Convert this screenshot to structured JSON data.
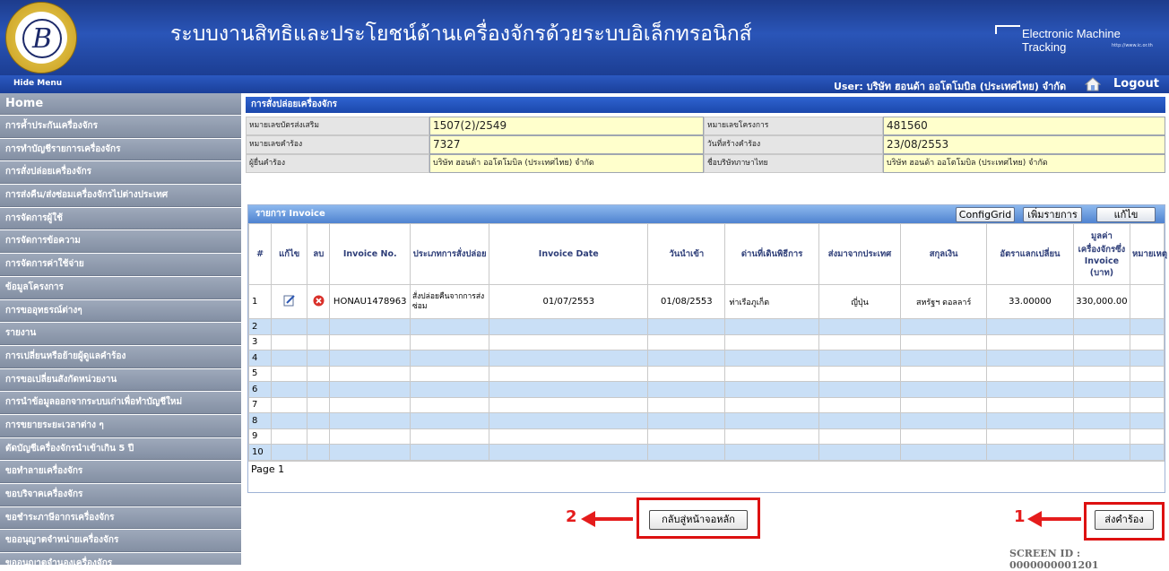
{
  "header": {
    "title": "ระบบงานสิทธิและประโยชน์ด้านเครื่องจักรด้วยระบบอิเล็กทรอนิกส์",
    "brand": "Electronic Machine Tracking",
    "brand_url": "http://www.ic.or.th"
  },
  "topbar": {
    "hide_menu": "Hide Menu",
    "user_text": "User: บริษัท ฮอนด้า ออโตโมบิล (ประเทศไทย) จำกัด",
    "logout": "Logout"
  },
  "sidebar": {
    "items": [
      {
        "label": "Home"
      },
      {
        "label": "การค้ำประกันเครื่องจักร"
      },
      {
        "label": "การทำบัญชีรายการเครื่องจักร"
      },
      {
        "label": "การสั่งปล่อยเครื่องจักร"
      },
      {
        "label": "การส่งคืน/ส่งซ่อมเครื่องจักรไปต่างประเทศ"
      },
      {
        "label": "การจัดการผู้ใช้"
      },
      {
        "label": "การจัดการข้อความ"
      },
      {
        "label": "การจัดการค่าใช้จ่าย"
      },
      {
        "label": "ข้อมูลโครงการ"
      },
      {
        "label": "การขออุทธรณ์ต่างๆ"
      },
      {
        "label": "รายงาน"
      },
      {
        "label": "การเปลี่ยนหรือย้ายผู้ดูแลคำร้อง"
      },
      {
        "label": "การขอเปลี่ยนสังกัดหน่วยงาน"
      },
      {
        "label": "การนำข้อมูลออกจากระบบเก่าเพื่อทำบัญชีใหม่"
      },
      {
        "label": "การขยายระยะเวลาต่าง ๆ"
      },
      {
        "label": "ตัดบัญชีเครื่องจักรนำเข้าเกิน 5 ปี"
      },
      {
        "label": "ขอทำลายเครื่องจักร"
      },
      {
        "label": "ขอบริจาคเครื่องจักร"
      },
      {
        "label": "ขอชำระภาษีอากรเครื่องจักร"
      },
      {
        "label": "ขออนุญาตจำหน่ายเครื่องจักร"
      },
      {
        "label": "ขออนุญาตจำนองเครื่องจักร"
      }
    ]
  },
  "form": {
    "title": "การสั่งปล่อยเครื่องจักร",
    "fields": {
      "promo_cert_label": "หมายเลขบัตรส่งเสริม",
      "promo_cert_value": "1507(2)/2549",
      "project_no_label": "หมายเลขโครงการ",
      "project_no_value": "481560",
      "request_no_label": "หมายเลขคำร้อง",
      "request_no_value": "7327",
      "created_date_label": "วันที่สร้างคำร้อง",
      "created_date_value": "23/08/2553",
      "requester_label": "ผู้ยื่นคำร้อง",
      "requester_value": "บริษัท ฮอนด้า ออโตโมบิล (ประเทศไทย) จำกัด",
      "company_th_label": "ชื่อบริษัทภาษาไทย",
      "company_th_value": "บริษัท ฮอนด้า ออโตโมบิล (ประเทศไทย) จำกัด"
    }
  },
  "invoice": {
    "title": "รายการ Invoice",
    "buttons": {
      "config": "ConfigGrid",
      "add": "เพิ่มรายการ",
      "edit": "แก้ไข"
    },
    "columns": [
      "#",
      "แก้ไข",
      "ลบ",
      "Invoice No.",
      "ประเภทการสั่งปล่อย",
      "Invoice Date",
      "วันนำเข้า",
      "ด่านที่เดินพิธีการ",
      "ส่งมาจากประเทศ",
      "สกุลเงิน",
      "อัตราแลกเปลี่ยน",
      "มูลค่าเครื่องจักรซึ่ง Invoice (บาท)",
      "หมายเหตุ"
    ],
    "rows": [
      {
        "n": "1",
        "invoice_no": "HONAU1478963",
        "type": "สั่งปล่อยคืนจากการส่งซ่อม",
        "invoice_date": "01/07/2553",
        "import_date": "01/08/2553",
        "port": "ท่าเรือภูเก็ต",
        "country": "ญี่ปุ่น",
        "currency": "สหรัฐฯ ดอลลาร์",
        "rate": "33.00000",
        "value": "330,000.00",
        "remark": ""
      }
    ],
    "empty_rows": [
      "2",
      "3",
      "4",
      "5",
      "6",
      "7",
      "8",
      "9",
      "10"
    ],
    "page_label": "Page 1"
  },
  "actions": {
    "back_home": "กลับสู่หน้าจอหลัก",
    "submit": "ส่งคำร้อง",
    "annotation_1": "1",
    "annotation_2": "2",
    "annotation_color": "#e51c1c"
  },
  "footer": {
    "screen_id": "SCREEN ID : 0000000001201"
  }
}
